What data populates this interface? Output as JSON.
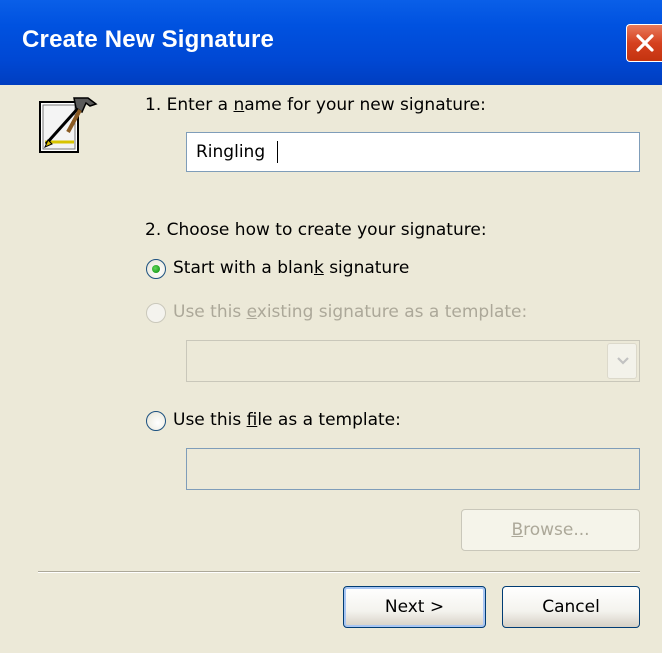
{
  "window": {
    "title": "Create New Signature"
  },
  "step1": {
    "label_pre": "1. Enter a ",
    "label_access": "n",
    "label_post": "ame for your new signature:",
    "name_value": "Ringling"
  },
  "step2": {
    "label": "2. Choose how to create your signature:",
    "options": [
      {
        "pre": "Start with a blan",
        "access": "k",
        "post": " signature",
        "selected": true,
        "enabled": true
      },
      {
        "pre": "Use this ",
        "access": "e",
        "post": "xisting signature as a template:",
        "selected": false,
        "enabled": false
      },
      {
        "pre": "Use this ",
        "access": "f",
        "post": "ile as a template:",
        "selected": false,
        "enabled": true
      }
    ],
    "existing_select_value": "",
    "file_value": ""
  },
  "buttons": {
    "browse_access": "B",
    "browse_rest": "rowse...",
    "next": "Next >",
    "cancel": "Cancel"
  },
  "colors": {
    "titlebar": "#0052e0",
    "dialog_bg": "#ece9d8",
    "radio_selected": "#21a121",
    "disabled_text": "#aca899"
  },
  "icons": {
    "close": "close-icon",
    "signature": "signature-pen-icon",
    "dropdown": "chevron-down-icon"
  }
}
